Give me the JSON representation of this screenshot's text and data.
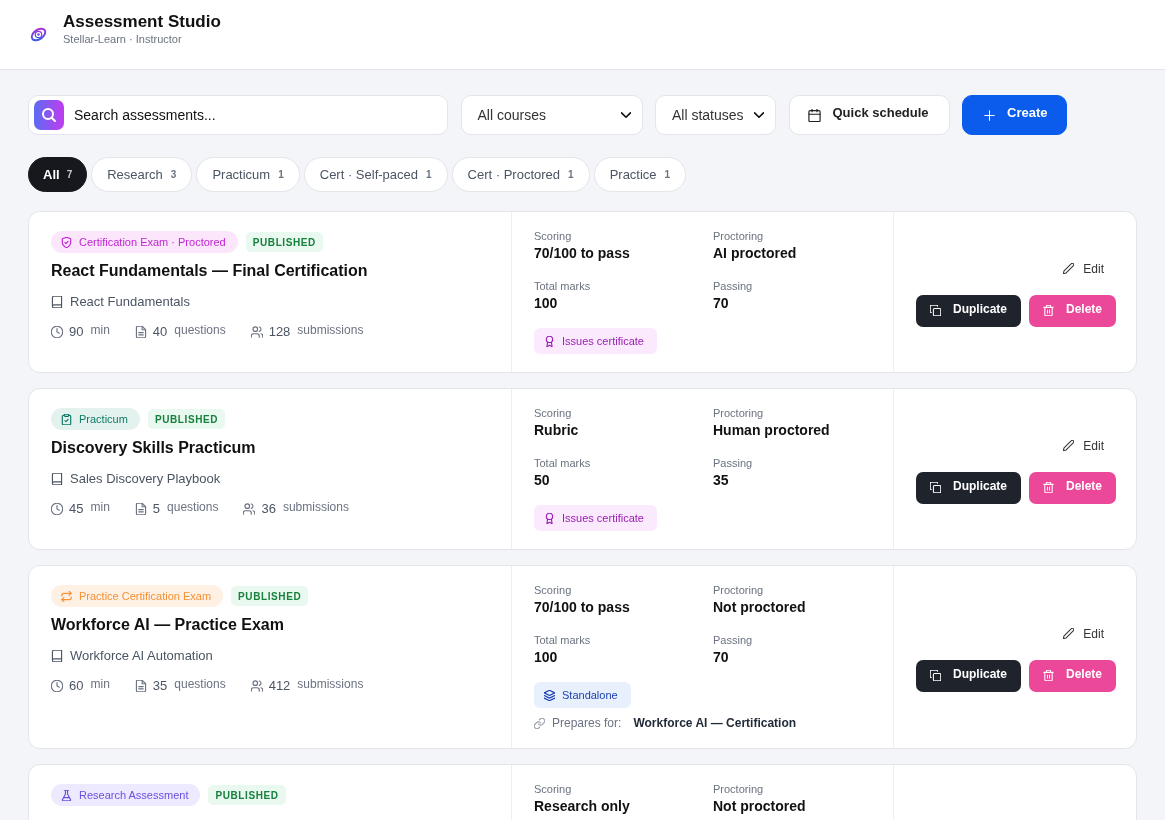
{
  "header": {
    "title": "Assessment Studio",
    "subtitle": "Stellar-Learn · Instructor"
  },
  "toolbar": {
    "search": {
      "placeholder": "Search assessments..."
    },
    "filters": [
      {
        "kind": "course",
        "value": "All courses"
      },
      {
        "kind": "status",
        "value": "All statuses"
      }
    ],
    "buttons": [
      {
        "kind": "schedule",
        "label": "Quick schedule"
      },
      {
        "kind": "create",
        "label": "Create"
      }
    ]
  },
  "filter_tabs": [
    {
      "label": "All",
      "count": "7",
      "selected": true
    },
    {
      "label": "Research",
      "count": "3",
      "selected": false
    },
    {
      "label": "Practicum",
      "count": "1",
      "selected": false
    },
    {
      "label": "Cert · Self-paced",
      "count": "1",
      "selected": false
    },
    {
      "label": "Cert · Proctored",
      "count": "1",
      "selected": false
    },
    {
      "label": "Practice",
      "count": "1",
      "selected": false
    }
  ],
  "assessments": [
    {
      "type": {
        "kind": "cert-proctored",
        "label": "Certification Exam · Proctored"
      },
      "status": "PUBLISHED",
      "title": "React Fundamentals — Final Certification",
      "course": "React Fundamentals",
      "stats": [
        {
          "kind": "duration",
          "value": "90",
          "unit": "min"
        },
        {
          "kind": "questions",
          "value": "40",
          "unit": "questions"
        },
        {
          "kind": "submissions",
          "value": "128",
          "unit": "submissions"
        }
      ],
      "details": [
        {
          "label": "Scoring",
          "value": "70/100 to pass"
        },
        {
          "label": "Proctoring",
          "value": "AI proctored"
        },
        {
          "label": "Total marks",
          "value": "100"
        },
        {
          "label": "Passing",
          "value": "70"
        }
      ],
      "tags": [
        {
          "kind": "certificate",
          "label": "Issues certificate"
        }
      ],
      "actions": [
        {
          "kind": "edit",
          "label": "Edit"
        },
        {
          "kind": "duplicate",
          "label": "Duplicate"
        },
        {
          "kind": "delete",
          "label": "Delete"
        }
      ]
    },
    {
      "type": {
        "kind": "practicum",
        "label": "Practicum"
      },
      "status": "PUBLISHED",
      "title": "Discovery Skills Practicum",
      "course": "Sales Discovery Playbook",
      "stats": [
        {
          "kind": "duration",
          "value": "45",
          "unit": "min"
        },
        {
          "kind": "questions",
          "value": "5",
          "unit": "questions"
        },
        {
          "kind": "submissions",
          "value": "36",
          "unit": "submissions"
        }
      ],
      "details": [
        {
          "label": "Scoring",
          "value": "Rubric"
        },
        {
          "label": "Proctoring",
          "value": "Human proctored"
        },
        {
          "label": "Total marks",
          "value": "50"
        },
        {
          "label": "Passing",
          "value": "35"
        }
      ],
      "tags": [
        {
          "kind": "certificate",
          "label": "Issues certificate"
        }
      ],
      "actions": [
        {
          "kind": "edit",
          "label": "Edit"
        },
        {
          "kind": "duplicate",
          "label": "Duplicate"
        },
        {
          "kind": "delete",
          "label": "Delete"
        }
      ]
    },
    {
      "type": {
        "kind": "practice",
        "label": "Practice Certification Exam"
      },
      "status": "PUBLISHED",
      "title": "Workforce AI — Practice Exam",
      "course": "Workforce AI Automation",
      "stats": [
        {
          "kind": "duration",
          "value": "60",
          "unit": "min"
        },
        {
          "kind": "questions",
          "value": "35",
          "unit": "questions"
        },
        {
          "kind": "submissions",
          "value": "412",
          "unit": "submissions"
        }
      ],
      "details": [
        {
          "label": "Scoring",
          "value": "70/100 to pass"
        },
        {
          "label": "Proctoring",
          "value": "Not proctored"
        },
        {
          "label": "Total marks",
          "value": "100"
        },
        {
          "label": "Passing",
          "value": "70"
        }
      ],
      "tags": [
        {
          "kind": "standalone",
          "label": "Standalone"
        }
      ],
      "prepares_for": {
        "label": "Prepares for:",
        "target": "Workforce AI — Certification"
      },
      "actions": [
        {
          "kind": "edit",
          "label": "Edit"
        },
        {
          "kind": "duplicate",
          "label": "Duplicate"
        },
        {
          "kind": "delete",
          "label": "Delete"
        }
      ]
    },
    {
      "type": {
        "kind": "research",
        "label": "Research Assessment"
      },
      "status": "PUBLISHED",
      "details": [
        {
          "label": "Scoring",
          "value": "Research only"
        },
        {
          "label": "Proctoring",
          "value": "Not proctored"
        }
      ]
    }
  ]
}
